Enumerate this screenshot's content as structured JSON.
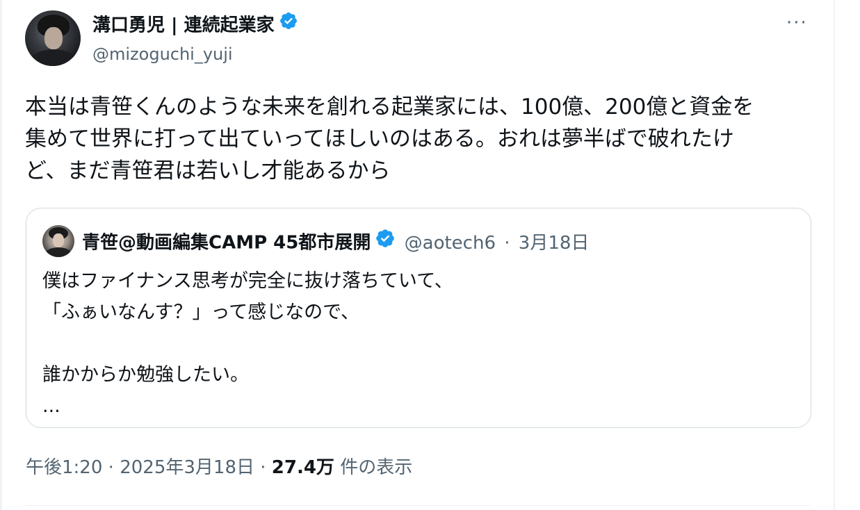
{
  "author": {
    "display_name": "溝口勇児 | 連続起業家",
    "handle": "@mizoguchi_yuji",
    "verified": true
  },
  "more_menu": "···",
  "tweet": {
    "lines": [
      "本当は青笹くんのような未来を創れる起業家には、100億、200億と資金を",
      "集めて世界に打って出ていってほしいのはある。おれは夢半ばで破れたけ",
      "ど、まだ青笹君は若いし才能あるから"
    ]
  },
  "quote": {
    "display_name": "青笹@動画編集CAMP 45都市展開",
    "handle": "@aotech6",
    "separator": "·",
    "date": "3月18日",
    "verified": true,
    "lines": [
      "僕はファイナンス思考が完全に抜け落ちていて、",
      "「ふぁいなんす？」って感じなので、",
      "",
      "誰かからか勉強したい。",
      "..."
    ]
  },
  "footer": {
    "time": "午後1:20",
    "sep1": "·",
    "date": "2025年3月18日",
    "sep2": "·",
    "views": "27.4万",
    "views_label": "件の表示"
  },
  "colors": {
    "text": "#0f1419",
    "muted": "#536471",
    "verified": "#1d9bf0",
    "border": "#cfd9de"
  },
  "icons": {
    "verified": "verified-badge-icon",
    "more": "more-horizontal-icon"
  }
}
